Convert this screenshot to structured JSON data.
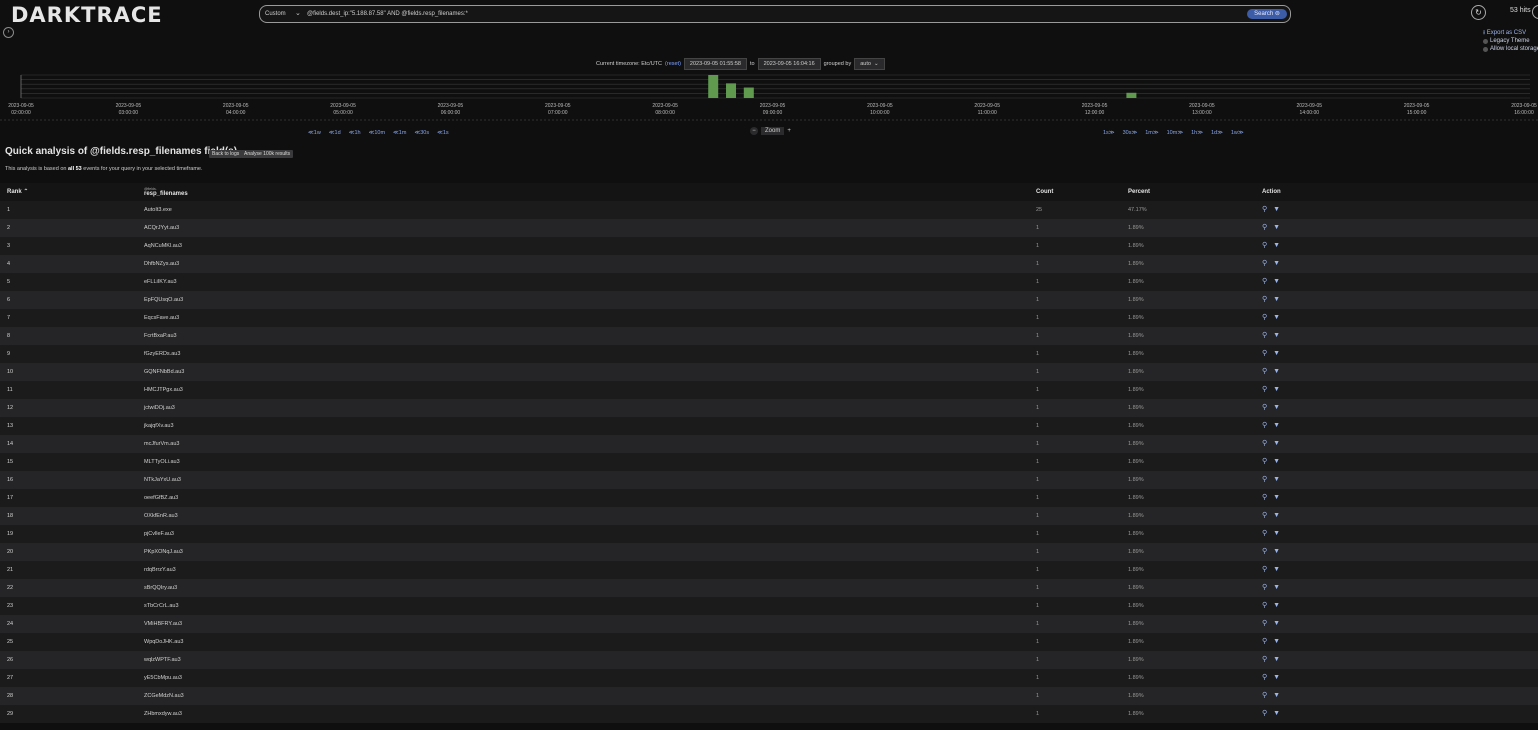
{
  "app": {
    "logo": "DARKTRACE"
  },
  "search": {
    "type": "Custom",
    "caret": "⌄",
    "query": "@fields.dest_ip:\"5.188.87.58\" AND @fields.resp_filenames:*",
    "button": "Search"
  },
  "hits": {
    "text": "53 hits"
  },
  "options": {
    "export": "⭳ Export as CSV",
    "legacy": "Legacy Theme",
    "local": "Allow local storage"
  },
  "timezone": {
    "label": "Current timezone: Etc/UTC",
    "reset": "(reset)",
    "from": "2023-09-05 01:55:58",
    "to_label": "to",
    "to": "2023-09-05 16:04:16",
    "grouped_label": "grouped by",
    "grouped_value": "auto"
  },
  "histogram": {
    "ticks": [
      {
        "d": "2023-09-05",
        "t": "02:00:00"
      },
      {
        "d": "2023-09-05",
        "t": "03:00:00"
      },
      {
        "d": "2023-09-05",
        "t": "04:00:00"
      },
      {
        "d": "2023-09-05",
        "t": "05:00:00"
      },
      {
        "d": "2023-09-05",
        "t": "06:00:00"
      },
      {
        "d": "2023-09-05",
        "t": "07:00:00"
      },
      {
        "d": "2023-09-05",
        "t": "08:00:00"
      },
      {
        "d": "2023-09-05",
        "t": "09:00:00"
      },
      {
        "d": "2023-09-05",
        "t": "10:00:00"
      },
      {
        "d": "2023-09-05",
        "t": "11:00:00"
      },
      {
        "d": "2023-09-05",
        "t": "12:00:00"
      },
      {
        "d": "2023-09-05",
        "t": "13:00:00"
      },
      {
        "d": "2023-09-05",
        "t": "14:00:00"
      },
      {
        "d": "2023-09-05",
        "t": "15:00:00"
      },
      {
        "d": "2023-09-05",
        "t": "16:00:00"
      }
    ],
    "bars": [
      {
        "x": "08:25",
        "v": 22
      },
      {
        "x": "08:35",
        "v": 14
      },
      {
        "x": "08:45",
        "v": 10
      },
      {
        "x": "12:20",
        "v": 5
      }
    ],
    "bar_color": "#5f9a4f"
  },
  "nav": {
    "back": [
      "≪1w",
      "≪1d",
      "≪1h",
      "≪10m",
      "≪1m",
      "≪30s",
      "≪1s"
    ],
    "zoom_minus": "−",
    "zoom": "Zoom",
    "zoom_plus": "+",
    "forward": [
      "1s≫",
      "30s≫",
      "1m≫",
      "10m≫",
      "1h≫",
      "1d≫",
      "1w≫"
    ]
  },
  "analysis": {
    "title": "Quick analysis of @fields.resp_filenames field(s)",
    "back_btn": "Back to logs",
    "analyse_btn": "Analyse 100k results",
    "subtitle_pre": "This analysis is based on ",
    "subtitle_bold": "all 53",
    "subtitle_post": " events for your query in your selected timeframe."
  },
  "table": {
    "headers": {
      "rank": "Rank ⌃",
      "name_small": "@fields.",
      "name": "resp_filenames",
      "count": "Count",
      "percent": "Percent",
      "action": "Action"
    },
    "rows": [
      {
        "rank": "1",
        "name": "AutoIt3.exe",
        "count": "25",
        "pct": "47.17%"
      },
      {
        "rank": "2",
        "name": "ACQrJYyt.au3",
        "count": "1",
        "pct": "1.89%"
      },
      {
        "rank": "3",
        "name": "AqNCuMKl.au3",
        "count": "1",
        "pct": "1.89%"
      },
      {
        "rank": "4",
        "name": "DhfbNZys.au3",
        "count": "1",
        "pct": "1.89%"
      },
      {
        "rank": "5",
        "name": "eFLLiIKY.au3",
        "count": "1",
        "pct": "1.89%"
      },
      {
        "rank": "6",
        "name": "EpFQUsqO.au3",
        "count": "1",
        "pct": "1.89%"
      },
      {
        "rank": "7",
        "name": "EqcsFave.au3",
        "count": "1",
        "pct": "1.89%"
      },
      {
        "rank": "8",
        "name": "FcrtBxaP.au3",
        "count": "1",
        "pct": "1.89%"
      },
      {
        "rank": "9",
        "name": "fGzyERDs.au3",
        "count": "1",
        "pct": "1.89%"
      },
      {
        "rank": "10",
        "name": "GQNFNbBd.au3",
        "count": "1",
        "pct": "1.89%"
      },
      {
        "rank": "11",
        "name": "HMCJTPgx.au3",
        "count": "1",
        "pct": "1.89%"
      },
      {
        "rank": "12",
        "name": "jctwiDOj.au3",
        "count": "1",
        "pct": "1.89%"
      },
      {
        "rank": "13",
        "name": "jkajqfXv.au3",
        "count": "1",
        "pct": "1.89%"
      },
      {
        "rank": "14",
        "name": "mcJfurVm.au3",
        "count": "1",
        "pct": "1.89%"
      },
      {
        "rank": "15",
        "name": "MLTTyOLi.au3",
        "count": "1",
        "pct": "1.89%"
      },
      {
        "rank": "16",
        "name": "NTkJaYxU.au3",
        "count": "1",
        "pct": "1.89%"
      },
      {
        "rank": "17",
        "name": "oeefGfBZ.au3",
        "count": "1",
        "pct": "1.89%"
      },
      {
        "rank": "18",
        "name": "OXkfEnR.au3",
        "count": "1",
        "pct": "1.89%"
      },
      {
        "rank": "19",
        "name": "pjCvlleF.au3",
        "count": "1",
        "pct": "1.89%"
      },
      {
        "rank": "20",
        "name": "PKpXONqJ.au3",
        "count": "1",
        "pct": "1.89%"
      },
      {
        "rank": "21",
        "name": "rdqBrrzY.au3",
        "count": "1",
        "pct": "1.89%"
      },
      {
        "rank": "22",
        "name": "sBrQQIry.au3",
        "count": "1",
        "pct": "1.89%"
      },
      {
        "rank": "23",
        "name": "sTbCrCrL.au3",
        "count": "1",
        "pct": "1.89%"
      },
      {
        "rank": "24",
        "name": "VMiHBFRY.au3",
        "count": "1",
        "pct": "1.89%"
      },
      {
        "rank": "25",
        "name": "WpqDoJHK.au3",
        "count": "1",
        "pct": "1.89%"
      },
      {
        "rank": "26",
        "name": "wqlzWPTF.au3",
        "count": "1",
        "pct": "1.89%"
      },
      {
        "rank": "27",
        "name": "yE5CbMpu.au3",
        "count": "1",
        "pct": "1.89%"
      },
      {
        "rank": "28",
        "name": "ZCGeMdzN.au3",
        "count": "1",
        "pct": "1.89%"
      },
      {
        "rank": "29",
        "name": "ZHbmxdyw.au3",
        "count": "1",
        "pct": "1.89%"
      }
    ]
  },
  "icons": {
    "search": "search-icon",
    "filter": "filter-icon"
  }
}
